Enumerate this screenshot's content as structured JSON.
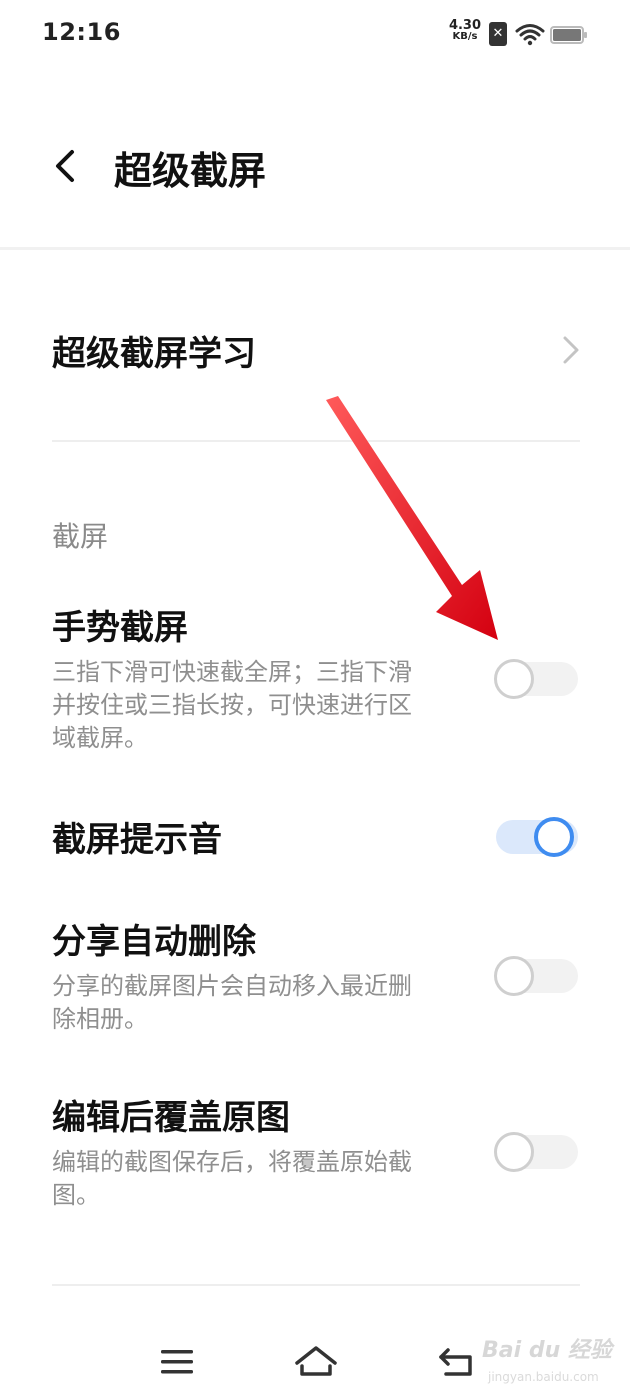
{
  "status_bar": {
    "time": "12:16",
    "net_speed_value": "4.30",
    "net_speed_unit": "KB/s",
    "sim_icon": "sim-off-icon",
    "sim_icon_glyph": "✕",
    "wifi_icon": "wifi-icon",
    "battery_icon": "battery-icon"
  },
  "header": {
    "back_icon": "chevron-left-icon",
    "title": "超级截屏"
  },
  "learn_row": {
    "label": "超级截屏学习",
    "icon": "chevron-right-icon"
  },
  "section": {
    "header": "截屏"
  },
  "settings": [
    {
      "title": "手势截屏",
      "description": "三指下滑可快速截全屏；三指下滑并按住或三指长按，可快速进行区域截屏。",
      "enabled": false
    },
    {
      "title": "截屏提示音",
      "description": "",
      "enabled": true
    },
    {
      "title": "分享自动删除",
      "description": "分享的截屏图片会自动移入最近删除相册。",
      "enabled": false
    },
    {
      "title": "编辑后覆盖原图",
      "description": "编辑的截图保存后，将覆盖原始截图。",
      "enabled": false
    }
  ],
  "nav_bar": {
    "menu_icon": "menu-icon",
    "home_icon": "home-icon",
    "back_icon": "back-icon"
  },
  "watermark": {
    "logo": "Bai du 经验",
    "url": "jingyan.baidu.com"
  },
  "colors": {
    "accent": "#3f8cf0",
    "toggle_on_track": "#dbe8fb",
    "annotation_arrow": "#e8101a",
    "secondary_text": "#8f8f8f"
  }
}
